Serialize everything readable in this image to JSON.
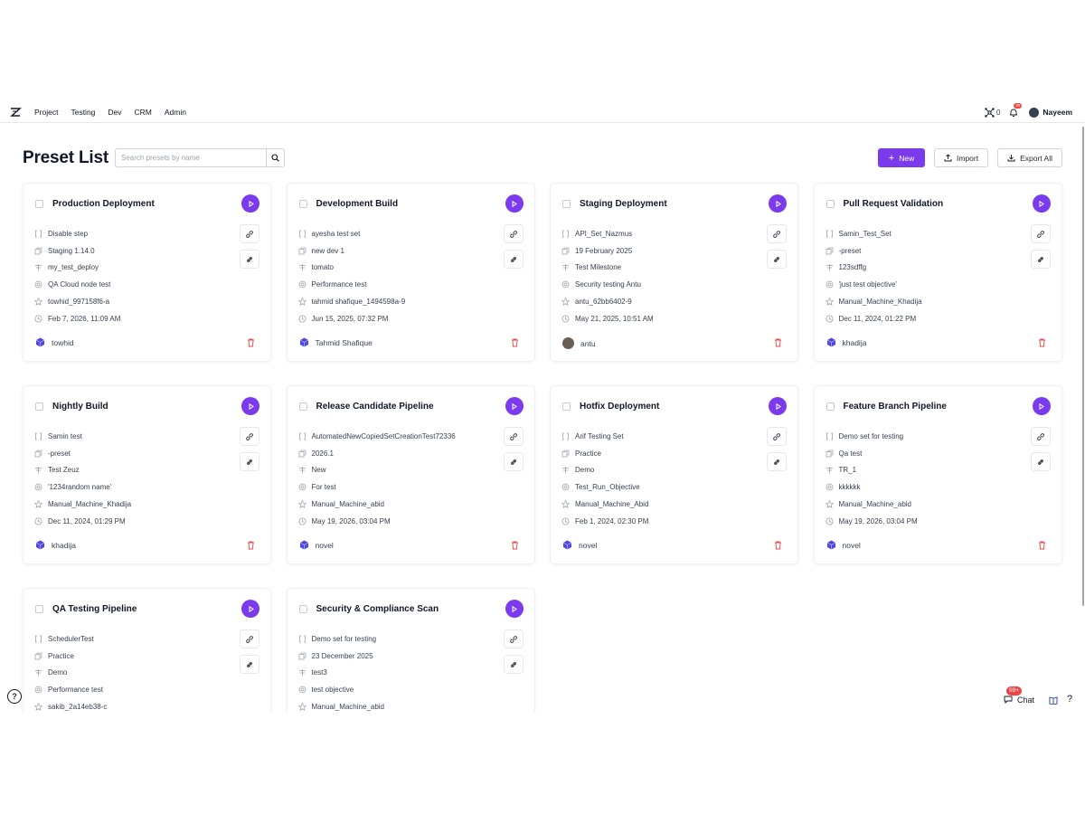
{
  "nav": {
    "items": [
      "Project",
      "Testing",
      "Dev",
      "CRM",
      "Admin"
    ],
    "node_count": "0",
    "notification_badge": "99",
    "user_name": "Nayeem"
  },
  "header": {
    "title": "Preset List",
    "search_placeholder": "Search presets by name",
    "new_label": "New",
    "import_label": "Import",
    "export_label": "Export All"
  },
  "colors": {
    "accent": "#7c3aed",
    "danger": "#ef4444"
  },
  "field_icons": [
    "brackets-icon",
    "copy-icon",
    "milestone-icon",
    "target-icon",
    "machine-icon",
    "clock-icon"
  ],
  "presets": [
    {
      "title": "Production Deployment",
      "fields": [
        "Disable step",
        "Staging 1.14.0",
        "my_test_deploy",
        "QA Cloud node test",
        "towhid_997158f6-a",
        "Feb 7, 2026, 11:09 AM"
      ],
      "owner": "towhid",
      "owner_avatar": "cube"
    },
    {
      "title": "Development Build",
      "fields": [
        "ayesha test set",
        "new dev 1",
        "tomato",
        "Performance test",
        "tahmid shafique_1494598a-9",
        "Jun 15, 2025, 07:32 PM"
      ],
      "owner": "Tahmid Shafique",
      "owner_avatar": "cube"
    },
    {
      "title": "Staging Deployment",
      "fields": [
        "API_Set_Nazmus",
        "19 February 2025",
        "Test Milestone",
        "Security testing Antu",
        "antu_62bb6402-9",
        "May 21, 2025, 10:51 AM"
      ],
      "owner": "antu",
      "owner_avatar": "photo"
    },
    {
      "title": "Pull Request Validation",
      "fields": [
        "Samin_Test_Set",
        "-preset",
        "123sdffg",
        "'just test objective'",
        "Manual_Machine_Khadija",
        "Dec 11, 2024, 01:22 PM"
      ],
      "owner": "khadija",
      "owner_avatar": "cube"
    },
    {
      "title": "Nightly Build",
      "fields": [
        "Samin test",
        "-preset",
        "Test Zeuz",
        "'1234random name'",
        "Manual_Machine_Khadija",
        "Dec 11, 2024, 01:29 PM"
      ],
      "owner": "khadija",
      "owner_avatar": "cube"
    },
    {
      "title": "Release Candidate Pipeline",
      "fields": [
        "AutomatedNewCopiedSetCreationTest72336",
        "2026.1",
        "New",
        "For test",
        "Manual_Machine_abid",
        "May 19, 2026, 03:04 PM"
      ],
      "owner": "novel",
      "owner_avatar": "cube"
    },
    {
      "title": "Hotfix Deployment",
      "fields": [
        "Arif Testing Set",
        "Practice",
        "Demo",
        "Test_Run_Objective",
        "Manual_Machine_Abid",
        "Feb 1, 2024, 02:30 PM"
      ],
      "owner": "novel",
      "owner_avatar": "cube"
    },
    {
      "title": "Feature Branch Pipeline",
      "fields": [
        "Demo set for testing",
        "Qa test",
        "TR_1",
        "kkkkkk",
        "Manual_Machine_abid",
        "May 19, 2026, 03:04 PM"
      ],
      "owner": "novel",
      "owner_avatar": "cube"
    },
    {
      "title": "QA Testing Pipeline",
      "fields": [
        "SchedulerTest",
        "Practice",
        "Demo",
        "Performance test",
        "sakib_2a14eb38-c",
        ""
      ],
      "owner": "",
      "owner_avatar": "cube"
    },
    {
      "title": "Security & Compliance Scan",
      "fields": [
        "Demo set for testing",
        "23 December 2025",
        "test3",
        "test objective",
        "Manual_Machine_abid",
        ""
      ],
      "owner": "",
      "owner_avatar": "cube"
    }
  ],
  "floating": {
    "chat_label": "Chat",
    "chat_badge": "99+"
  }
}
